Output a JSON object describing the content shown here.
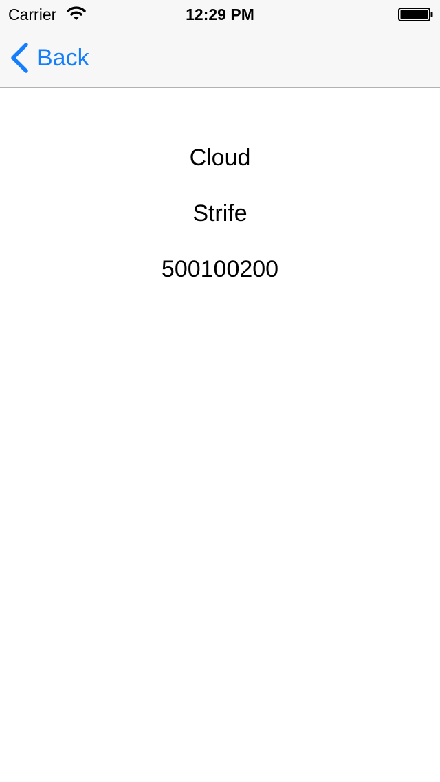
{
  "status_bar": {
    "carrier": "Carrier",
    "time": "12:29 PM",
    "wifi_icon": "wifi-icon",
    "battery_icon": "battery-icon",
    "battery_level": 1.0
  },
  "nav": {
    "back_label": "Back",
    "back_icon": "chevron-left-icon",
    "tint_color": "#157efb"
  },
  "content": {
    "first_name": "Cloud",
    "last_name": "Strife",
    "number": "500100200"
  }
}
